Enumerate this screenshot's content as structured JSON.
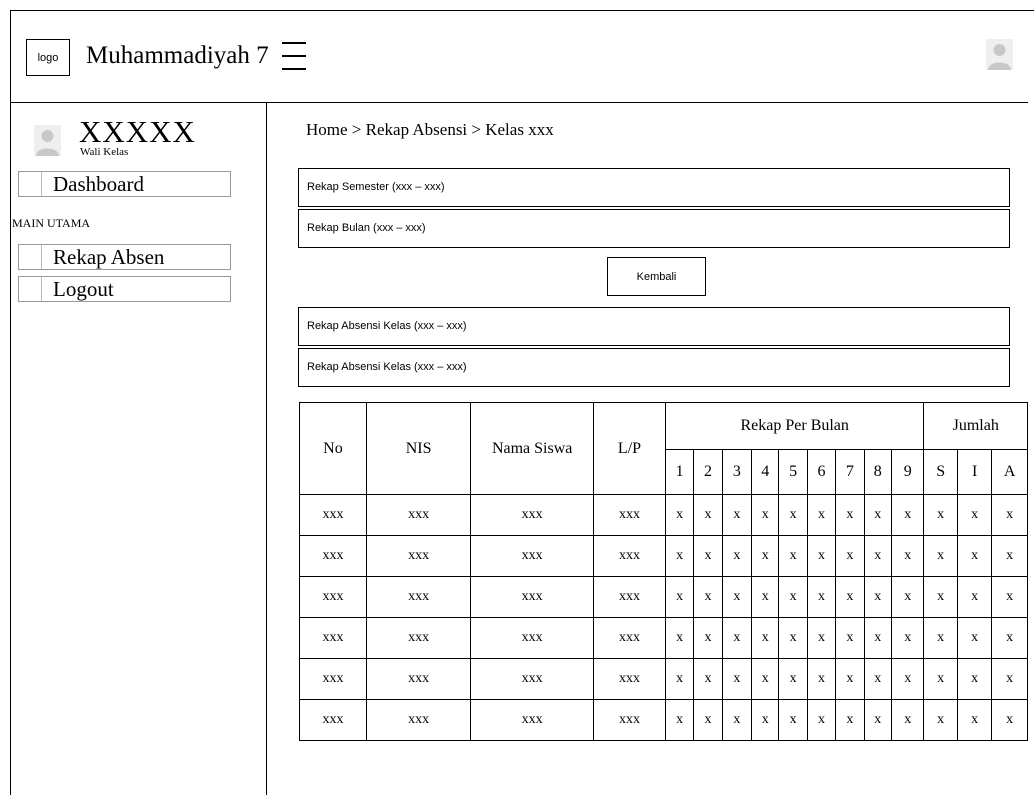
{
  "header": {
    "logo_text": "logo",
    "app_title": "Muhammadiyah 7"
  },
  "sidebar": {
    "user_name": "XXXXX",
    "user_role": "Wali Kelas",
    "dashboard_label": "Dashboard",
    "section_label": "MAIN UTAMA",
    "items": [
      {
        "label": "Rekap Absen"
      },
      {
        "label": "Logout"
      }
    ]
  },
  "main": {
    "breadcrumb": "Home > Rekap Absensi > Kelas xxx",
    "panels_top": [
      {
        "label": "Rekap Semester (xxx – xxx)"
      },
      {
        "label": "Rekap Bulan (xxx – xxx)"
      }
    ],
    "back_button": "Kembali",
    "panels_bottom": [
      {
        "label": "Rekap Absensi Kelas (xxx – xxx)"
      },
      {
        "label": "Rekap Absensi Kelas (xxx – xxx)"
      }
    ],
    "table": {
      "headers": {
        "no": "No",
        "nis": "NIS",
        "name": "Nama Siswa",
        "gender": "L/P",
        "monthly_group": "Rekap Per Bulan",
        "total_group": "Jumlah"
      },
      "month_cols": [
        "1",
        "2",
        "3",
        "4",
        "5",
        "6",
        "7",
        "8",
        "9"
      ],
      "total_cols": [
        "S",
        "I",
        "A"
      ],
      "rows": [
        {
          "no": "xxx",
          "nis": "xxx",
          "name": "xxx",
          "gender": "xxx",
          "months": [
            "x",
            "x",
            "x",
            "x",
            "x",
            "x",
            "x",
            "x",
            "x"
          ],
          "totals": [
            "x",
            "x",
            "x"
          ]
        },
        {
          "no": "xxx",
          "nis": "xxx",
          "name": "xxx",
          "gender": "xxx",
          "months": [
            "x",
            "x",
            "x",
            "x",
            "x",
            "x",
            "x",
            "x",
            "x"
          ],
          "totals": [
            "x",
            "x",
            "x"
          ]
        },
        {
          "no": "xxx",
          "nis": "xxx",
          "name": "xxx",
          "gender": "xxx",
          "months": [
            "x",
            "x",
            "x",
            "x",
            "x",
            "x",
            "x",
            "x",
            "x"
          ],
          "totals": [
            "x",
            "x",
            "x"
          ]
        },
        {
          "no": "xxx",
          "nis": "xxx",
          "name": "xxx",
          "gender": "xxx",
          "months": [
            "x",
            "x",
            "x",
            "x",
            "x",
            "x",
            "x",
            "x",
            "x"
          ],
          "totals": [
            "x",
            "x",
            "x"
          ]
        },
        {
          "no": "xxx",
          "nis": "xxx",
          "name": "xxx",
          "gender": "xxx",
          "months": [
            "x",
            "x",
            "x",
            "x",
            "x",
            "x",
            "x",
            "x",
            "x"
          ],
          "totals": [
            "x",
            "x",
            "x"
          ]
        },
        {
          "no": "xxx",
          "nis": "xxx",
          "name": "xxx",
          "gender": "xxx",
          "months": [
            "x",
            "x",
            "x",
            "x",
            "x",
            "x",
            "x",
            "x",
            "x"
          ],
          "totals": [
            "x",
            "x",
            "x"
          ]
        }
      ]
    }
  },
  "icons": {
    "menu": "hamburger-menu-icon",
    "avatar": "user-avatar-icon",
    "nav": "nav-square-icon"
  },
  "colors": {
    "line": "#000000",
    "avatar_fill": "#c8c8c8",
    "nav_border": "#999999"
  }
}
